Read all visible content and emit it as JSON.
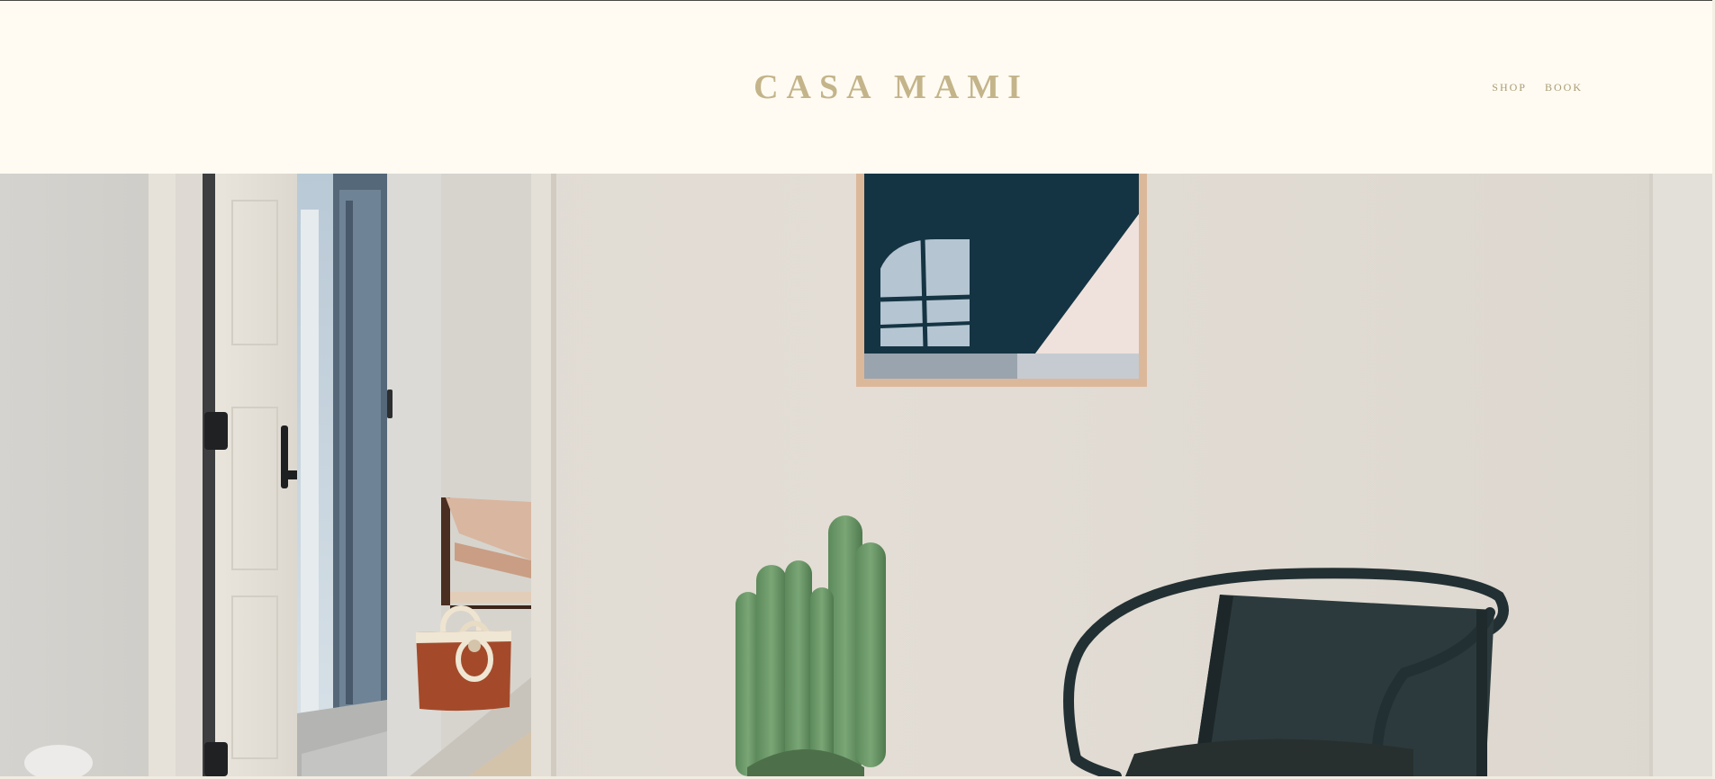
{
  "site": {
    "logo": "CASA MAMI"
  },
  "nav": {
    "items": [
      {
        "label": "SHOP"
      },
      {
        "label": "BOOK"
      }
    ]
  },
  "colors": {
    "background": "#fffbf2",
    "logo": "#c4b48a",
    "nav_link": "#a99c74"
  },
  "hero": {
    "description_icons": [
      "framed-art",
      "cactus-plant",
      "black-chair",
      "woven-bag",
      "open-door"
    ]
  }
}
